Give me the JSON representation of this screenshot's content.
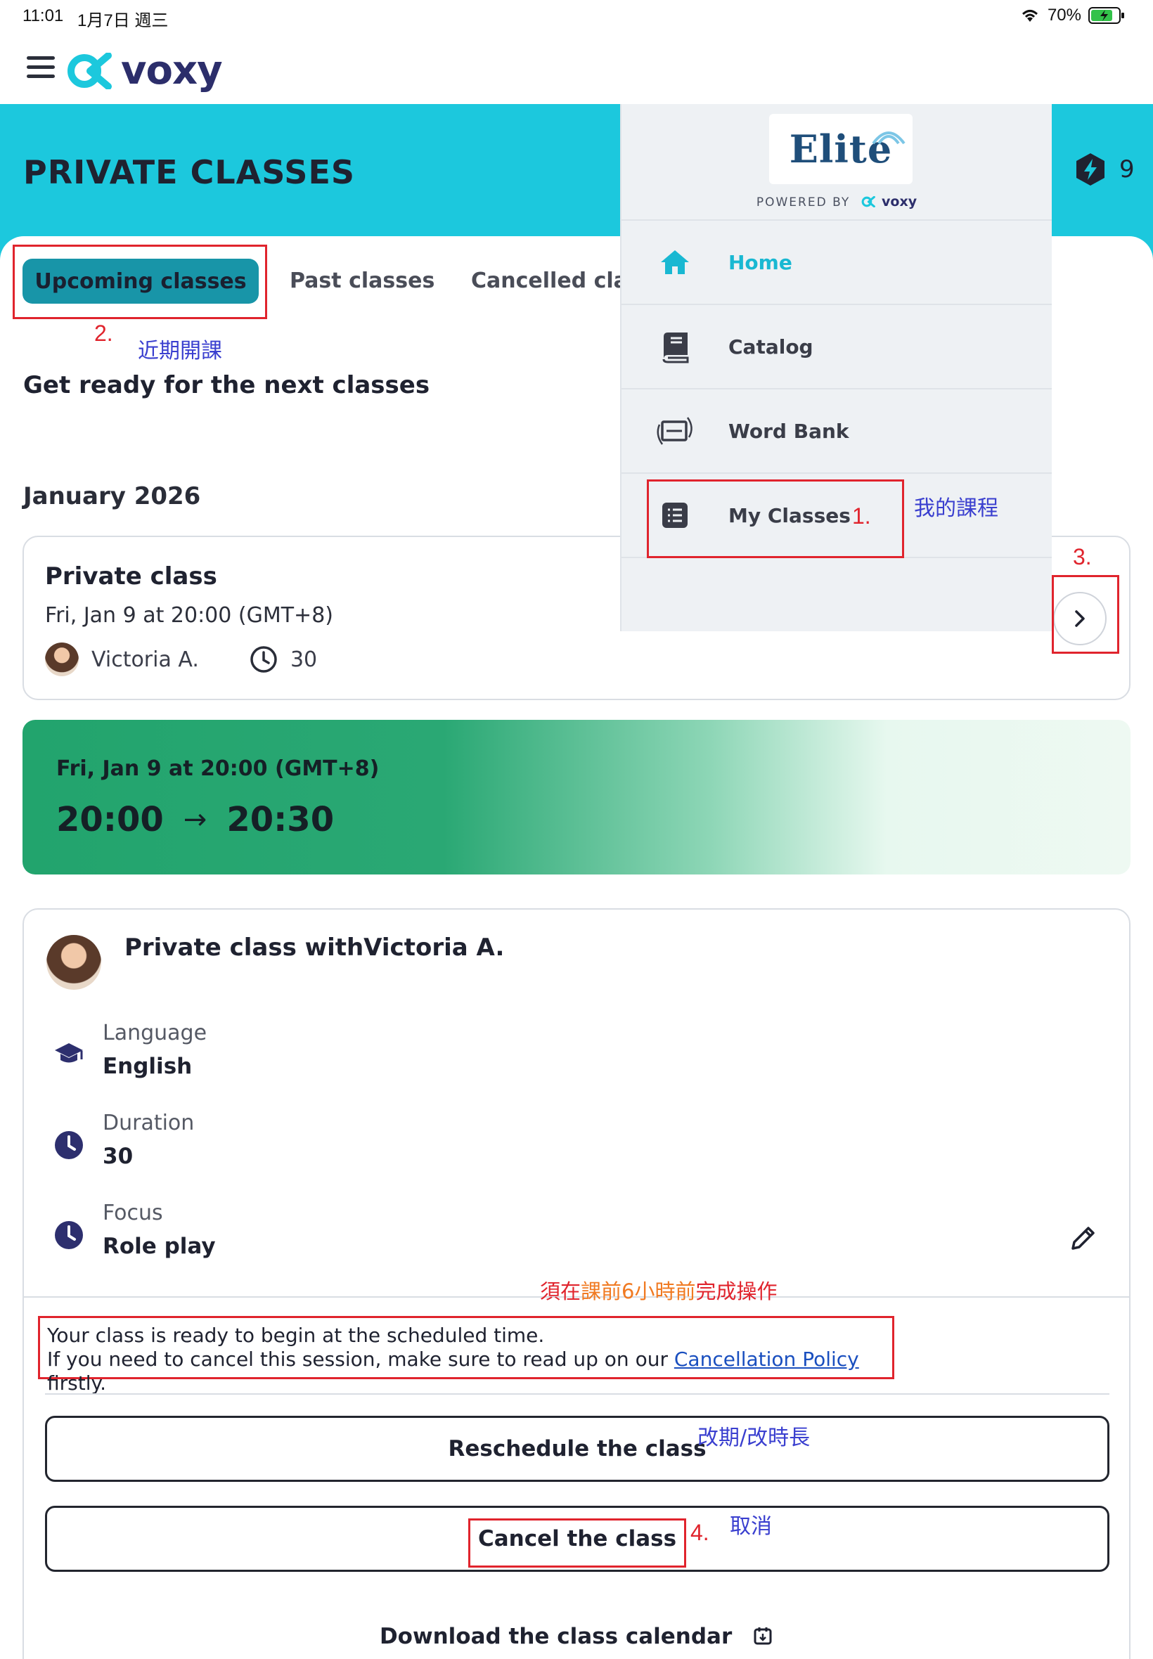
{
  "status_bar": {
    "time": "11:01",
    "date": "1月7日 週三",
    "battery": "70%"
  },
  "app": {
    "logo_text": "voxy",
    "page_title": "PRIVATE CLASSES",
    "badge_count": "9"
  },
  "tabs": [
    {
      "label": "Upcoming classes",
      "active": true
    },
    {
      "label": "Past classes",
      "active": false
    },
    {
      "label": "Cancelled clas",
      "active": false
    }
  ],
  "subheading": "Get ready for the next classes",
  "month": "January 2026",
  "class_card": {
    "title": "Private class",
    "date": "Fri, Jan 9 at 20:00 (GMT+8)",
    "teacher": "Victoria A.",
    "duration": "30"
  },
  "time_banner": {
    "date": "Fri, Jan 9 at 20:00 (GMT+8)",
    "start": "20:00",
    "arrow": "→",
    "end": "20:30"
  },
  "details": {
    "heading": "Private class withVictoria A.",
    "rows": [
      {
        "label": "Language",
        "value": "English",
        "icon": "graduation-cap-icon"
      },
      {
        "label": "Duration",
        "value": "30",
        "icon": "clock-icon"
      },
      {
        "label": "Focus",
        "value": "Role play",
        "icon": "clock-icon"
      }
    ],
    "notice_line1": "Your class is ready to begin at the scheduled time.",
    "notice_line2_pre": "If you need to cancel this session, make sure to read up on our ",
    "notice_link": "Cancellation Policy",
    "notice_line2_post": " firstly.",
    "reschedule_label": "Reschedule the class",
    "cancel_label": "Cancel the class",
    "download_label": "Download the class calendar"
  },
  "drawer": {
    "brand": "Elite",
    "powered_by": "POWERED BY",
    "powered_logo": "voxy",
    "items": [
      {
        "label": "Home",
        "icon": "home-icon",
        "active": true
      },
      {
        "label": "Catalog",
        "icon": "book-icon",
        "active": false
      },
      {
        "label": "Word Bank",
        "icon": "cards-icon",
        "active": false
      },
      {
        "label": "My Classes",
        "icon": "list-icon",
        "active": false
      }
    ]
  },
  "annotations": {
    "step1": "1.",
    "step1_text": "我的課程",
    "step2": "2.",
    "step2_text": "近期開課",
    "step3": "3.",
    "step4": "4.",
    "step4_text": "取消",
    "reschedule_text": "改期/改時長",
    "warning_part1": "須在",
    "warning_part2": "課前6小時前",
    "warning_part3": "完成操作"
  },
  "colors": {
    "teal": "#1cc8dd",
    "tab_active": "#1895a8",
    "annotation_red": "#e0242d",
    "annotation_blue": "#3a3fcf",
    "annotation_orange": "#f07a22",
    "banner_green": "#22a46d"
  }
}
